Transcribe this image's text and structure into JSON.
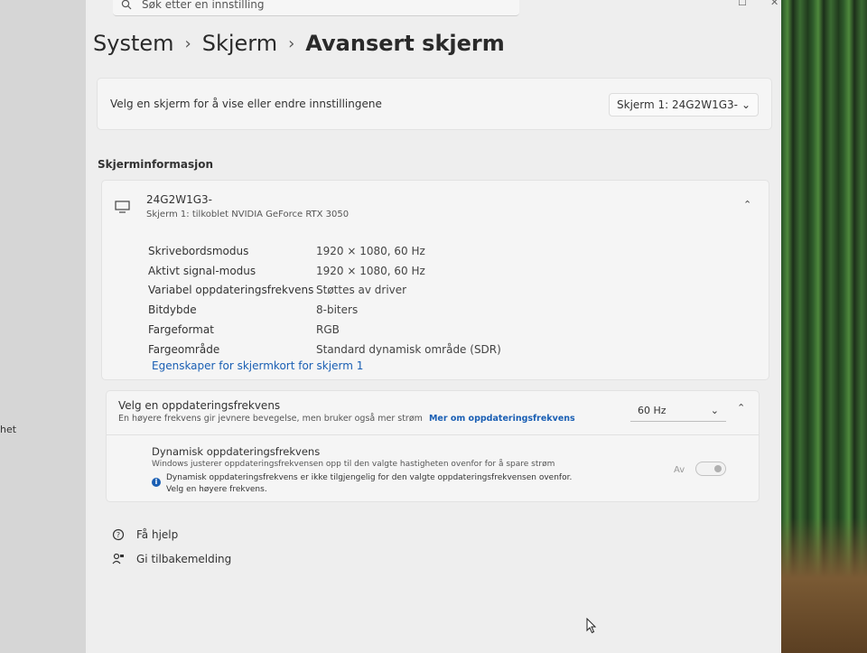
{
  "search": {
    "placeholder": "Søk etter en innstilling"
  },
  "breadcrumb": {
    "items": [
      "System",
      "Skjerm",
      "Avansert skjerm"
    ]
  },
  "display_select": {
    "label": "Velg en skjerm for å vise eller endre innstillingene",
    "value": "Skjerm 1: 24G2W1G3-"
  },
  "display_info": {
    "section_title": "Skjerminformasjon",
    "monitor_name": "24G2W1G3-",
    "monitor_subtitle": "Skjerm 1: tilkoblet NVIDIA GeForce RTX 3050",
    "rows": [
      {
        "key": "Skrivebordsmodus",
        "value": "1920 × 1080, 60 Hz"
      },
      {
        "key": "Aktivt signal-modus",
        "value": "1920 × 1080, 60 Hz"
      },
      {
        "key": "Variabel oppdateringsfrekvens",
        "value": "Støttes av driver"
      },
      {
        "key": "Bitdybde",
        "value": "8-biters"
      },
      {
        "key": "Fargeformat",
        "value": "RGB"
      },
      {
        "key": "Fargeområde",
        "value": "Standard dynamisk område (SDR)"
      }
    ],
    "adapter_link": "Egenskaper for skjermkort for skjerm 1"
  },
  "refresh": {
    "title": "Velg en oppdateringsfrekvens",
    "subtitle": "En høyere frekvens gir jevnere bevegelse, men bruker også mer strøm",
    "more_link": "Mer om oppdateringsfrekvens",
    "value": "60 Hz",
    "dynamic_title": "Dynamisk oppdateringsfrekvens",
    "dynamic_subtitle": "Windows justerer oppdateringsfrekvensen opp til den valgte hastigheten ovenfor for å spare strøm",
    "dynamic_warning": "Dynamisk oppdateringsfrekvens er ikke tilgjengelig for den valgte oppdateringsfrekvensen ovenfor. Velg en høyere frekvens.",
    "toggle_label": "Av"
  },
  "footer": {
    "help": "Få hjelp",
    "feedback": "Gi tilbakemelding"
  },
  "left_fragment": "het",
  "colors": {
    "accent": "#1a5fb4"
  }
}
